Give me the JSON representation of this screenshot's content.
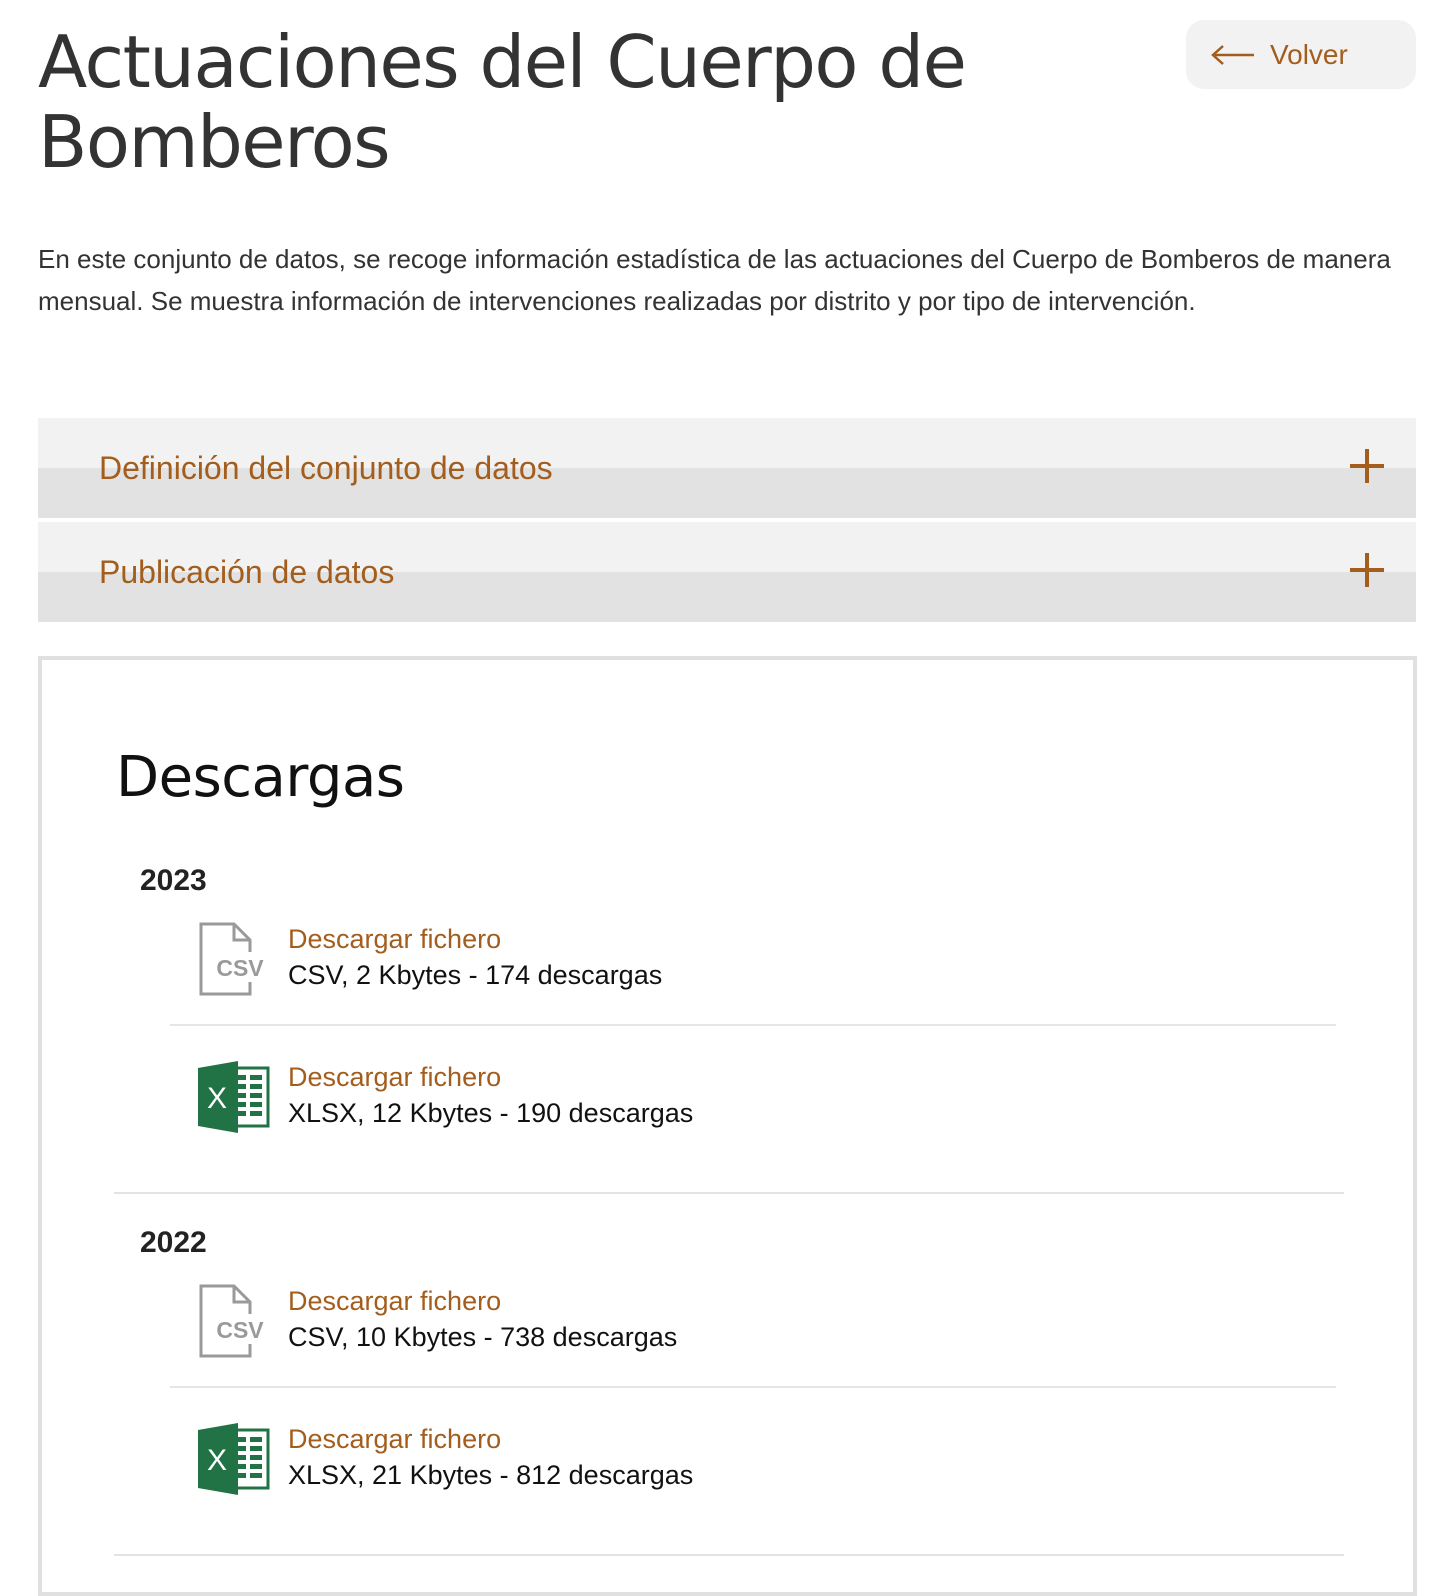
{
  "header": {
    "title": "Actuaciones del Cuerpo de Bomberos",
    "back_label": "Volver"
  },
  "intro": "En este conjunto de datos, se recoge información estadística de las actuaciones del Cuerpo de Bomberos de manera mensual. Se muestra información de intervenciones realizadas por distrito y por tipo de intervención.",
  "accordions": [
    {
      "label": "Definición del conjunto de datos",
      "icon": "plus-icon"
    },
    {
      "label": "Publicación de datos",
      "icon": "plus-icon"
    }
  ],
  "downloads": {
    "title": "Descargas",
    "years": [
      {
        "year": "2023",
        "files": [
          {
            "icon": "csv-file-icon",
            "icon_text": "CSV",
            "link": "Descargar fichero",
            "meta": "CSV, 2 Kbytes - 174 descargas"
          },
          {
            "icon": "excel-file-icon",
            "icon_text": "X",
            "link": "Descargar fichero",
            "meta": "XLSX, 12 Kbytes - 190 descargas"
          }
        ]
      },
      {
        "year": "2022",
        "files": [
          {
            "icon": "csv-file-icon",
            "icon_text": "CSV",
            "link": "Descargar fichero",
            "meta": "CSV, 10 Kbytes - 738 descargas"
          },
          {
            "icon": "excel-file-icon",
            "icon_text": "X",
            "link": "Descargar fichero",
            "meta": "XLSX, 21 Kbytes - 812 descargas"
          }
        ]
      }
    ]
  },
  "colors": {
    "accent": "#a35d1c",
    "excel_green": "#217346",
    "text": "#333333"
  }
}
